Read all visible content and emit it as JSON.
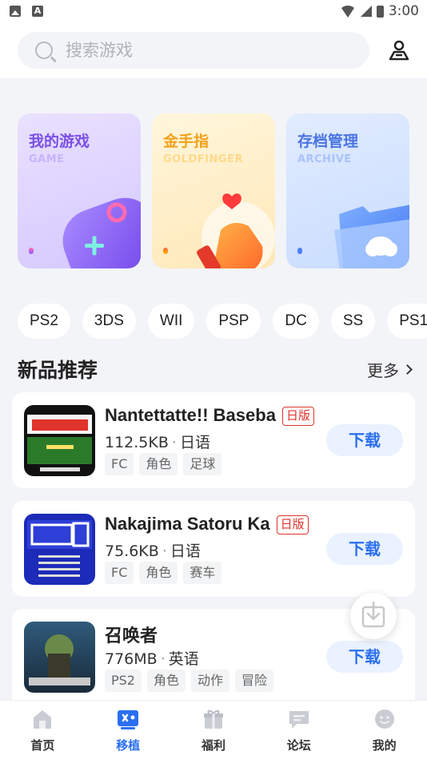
{
  "status_bar": {
    "time": "3:00"
  },
  "search": {
    "placeholder": "搜索游戏"
  },
  "feature_cards": [
    {
      "title": "我的游戏",
      "subtitle": "GAME",
      "icon": "gamepad-icon"
    },
    {
      "title": "金手指",
      "subtitle": "GOLDFINGER",
      "icon": "finger-heart-icon"
    },
    {
      "title": "存档管理",
      "subtitle": "ARCHIVE",
      "icon": "folder-cloud-icon"
    }
  ],
  "platforms": [
    "PS2",
    "3DS",
    "WII",
    "PSP",
    "DC",
    "SS",
    "PS1"
  ],
  "section": {
    "title": "新品推荐",
    "more": "更多"
  },
  "games": [
    {
      "name": "Nantettatte!! Baseba",
      "badge": "日版",
      "size": "112.5KB",
      "language": "日语",
      "tags": [
        "FC",
        "角色",
        "足球"
      ],
      "action": "下载"
    },
    {
      "name": "Nakajima Satoru Ka",
      "badge": "日版",
      "size": "75.6KB",
      "language": "日语",
      "tags": [
        "FC",
        "角色",
        "赛车"
      ],
      "action": "下载"
    },
    {
      "name": "召唤者",
      "badge": "",
      "size": "776MB",
      "language": "英语",
      "tags": [
        "PS2",
        "角色",
        "动作",
        "冒险"
      ],
      "action": "下载"
    }
  ],
  "bottom_nav": [
    {
      "label": "首页",
      "icon": "home-icon",
      "active": false
    },
    {
      "label": "移植",
      "icon": "port-icon",
      "active": true
    },
    {
      "label": "福利",
      "icon": "gift-icon",
      "active": false
    },
    {
      "label": "论坛",
      "icon": "forum-icon",
      "active": false
    },
    {
      "label": "我的",
      "icon": "profile-icon",
      "active": false
    }
  ],
  "colors": {
    "accent": "#2a6ff0",
    "badge_red": "#e0332b",
    "background": "#f3f4f8"
  }
}
